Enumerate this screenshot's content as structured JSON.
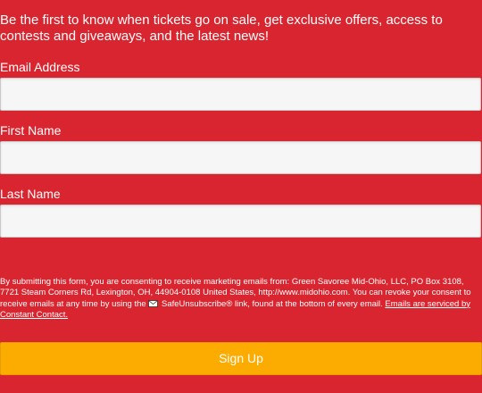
{
  "intro_text": "Be the first to know when tickets go on sale, get exclusive offers, access to contests and giveaways, and the latest news!",
  "fields": [
    {
      "label": "Email Address",
      "value": ""
    },
    {
      "label": "First Name",
      "value": ""
    },
    {
      "label": "Last Name",
      "value": ""
    }
  ],
  "consent": {
    "text_before_icon": "By submitting this form, you are consenting to receive marketing emails from: Green Savoree Mid-Ohio, LLC, PO Box 3108, 7721 Steam Corners Rd, Lexington, OH, 44904-0108 United States, http://www.midohio.com. You can revoke your consent to receive emails at any time by using the",
    "icon": "envelope-icon",
    "text_after_icon": " SafeUnsubscribe® link, found at the bottom of every email.",
    "link_text": "Emails are serviced by Constant Contact."
  },
  "submit_label": "Sign Up",
  "colors": {
    "background": "#d9252f",
    "button": "#fcab00",
    "input_background": "#f6f6f6"
  }
}
